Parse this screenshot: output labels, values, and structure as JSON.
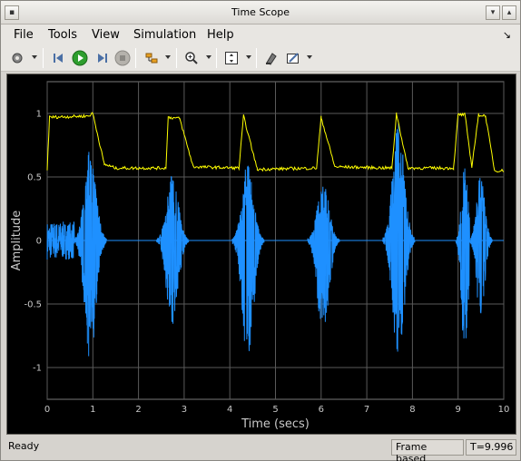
{
  "window": {
    "title": "Time Scope"
  },
  "menu": {
    "file": "File",
    "tools": "Tools",
    "view": "View",
    "simulation": "Simulation",
    "help": "Help"
  },
  "toolbar": {
    "icons": [
      "gear-icon",
      "step-back-icon",
      "run-icon",
      "step-forward-icon",
      "stop-icon",
      "signal-select-icon",
      "zoom-icon",
      "scale-axes-icon",
      "highlight-icon",
      "style-icon"
    ]
  },
  "status": {
    "ready": "Ready",
    "frame_mode": "Frame based",
    "time": "T=9.996"
  },
  "colors": {
    "background": "#000000",
    "grid": "#5a5a5a",
    "axis_text": "#c8c8c8",
    "series1": "#ffff00",
    "series2": "#1e90ff"
  },
  "chart_data": {
    "type": "line",
    "xlabel": "Time (secs)",
    "ylabel": "Amplitude",
    "xlim": [
      0,
      10
    ],
    "ylim": [
      -1.25,
      1.25
    ],
    "xticks": [
      "0",
      "1",
      "2",
      "3",
      "4",
      "5",
      "6",
      "7",
      "8",
      "9",
      "10"
    ],
    "yticks": [
      "1",
      "0.5",
      "0",
      "-0.5",
      "-1"
    ],
    "ytick_values": [
      1,
      0.5,
      0,
      -0.5,
      -1
    ],
    "grid": true,
    "series": [
      {
        "color": "#ffff00",
        "x": [
          0,
          0.05,
          0.9,
          1.0,
          1.25,
          1.5,
          2.6,
          2.65,
          2.9,
          3.2,
          4.2,
          4.3,
          4.6,
          5.9,
          6.0,
          6.3,
          7.55,
          7.65,
          7.9,
          8.9,
          9.0,
          9.15,
          9.3,
          9.45,
          9.6,
          9.8,
          10
        ],
        "values": [
          0.55,
          0.97,
          0.98,
          1.0,
          0.6,
          0.57,
          0.57,
          0.97,
          0.96,
          0.58,
          0.57,
          0.98,
          0.56,
          0.57,
          0.97,
          0.58,
          0.57,
          1.0,
          0.57,
          0.57,
          0.99,
          0.99,
          0.58,
          0.99,
          0.98,
          0.55,
          0.55
        ]
      },
      {
        "color": "#1e90ff",
        "bursts": [
          {
            "center": 0.95,
            "width": 0.35,
            "amp_pos": 0.75,
            "amp_neg": 1.0
          },
          {
            "center": 2.75,
            "width": 0.35,
            "amp_pos": 0.55,
            "amp_neg": 0.75
          },
          {
            "center": 4.4,
            "width": 0.35,
            "amp_pos": 0.65,
            "amp_neg": 1.0
          },
          {
            "center": 6.05,
            "width": 0.35,
            "amp_pos": 0.5,
            "amp_neg": 0.8
          },
          {
            "center": 7.7,
            "width": 0.35,
            "amp_pos": 1.0,
            "amp_neg": 1.0
          },
          {
            "center": 9.15,
            "width": 0.2,
            "amp_pos": 0.6,
            "amp_neg": 1.0
          },
          {
            "center": 9.5,
            "width": 0.25,
            "amp_pos": 0.55,
            "amp_neg": 0.65
          }
        ],
        "noise_segment": {
          "start": 0.0,
          "end": 0.9,
          "amp": 0.15
        }
      }
    ]
  }
}
